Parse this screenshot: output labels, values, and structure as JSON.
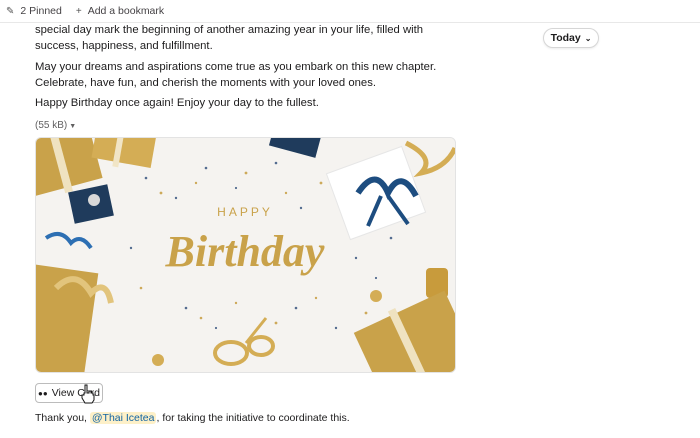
{
  "topbar": {
    "pinned_icon": "pin-icon",
    "pinned_label": "2 Pinned",
    "bookmark_icon": "plus-icon",
    "bookmark_label": "Add a bookmark"
  },
  "message": {
    "paragraph1": "special day mark the beginning of another amazing year in your life, filled with success, happiness, and fulfillment.",
    "paragraph2": "May your dreams and aspirations come true as you embark on this new chapter. Celebrate, have fun, and cherish the moments with your loved ones.",
    "paragraph3": "Happy Birthday once again! Enjoy your day to the fullest.",
    "file_size": "(55 kB)",
    "card": {
      "line1": "HAPPY",
      "line2": "Birthday"
    },
    "view_button_label": "View Card",
    "thanks_before": "Thank you, ",
    "thanks_mention": "@Thai Icetea",
    "thanks_after": ", for taking the initiative to coordinate this."
  },
  "date_divider": {
    "label": "Today"
  },
  "colors": {
    "gold": "#c9a24a",
    "navy": "#1f3b5c",
    "mention_bg": "#fdf0c8",
    "link": "#1264a3"
  }
}
